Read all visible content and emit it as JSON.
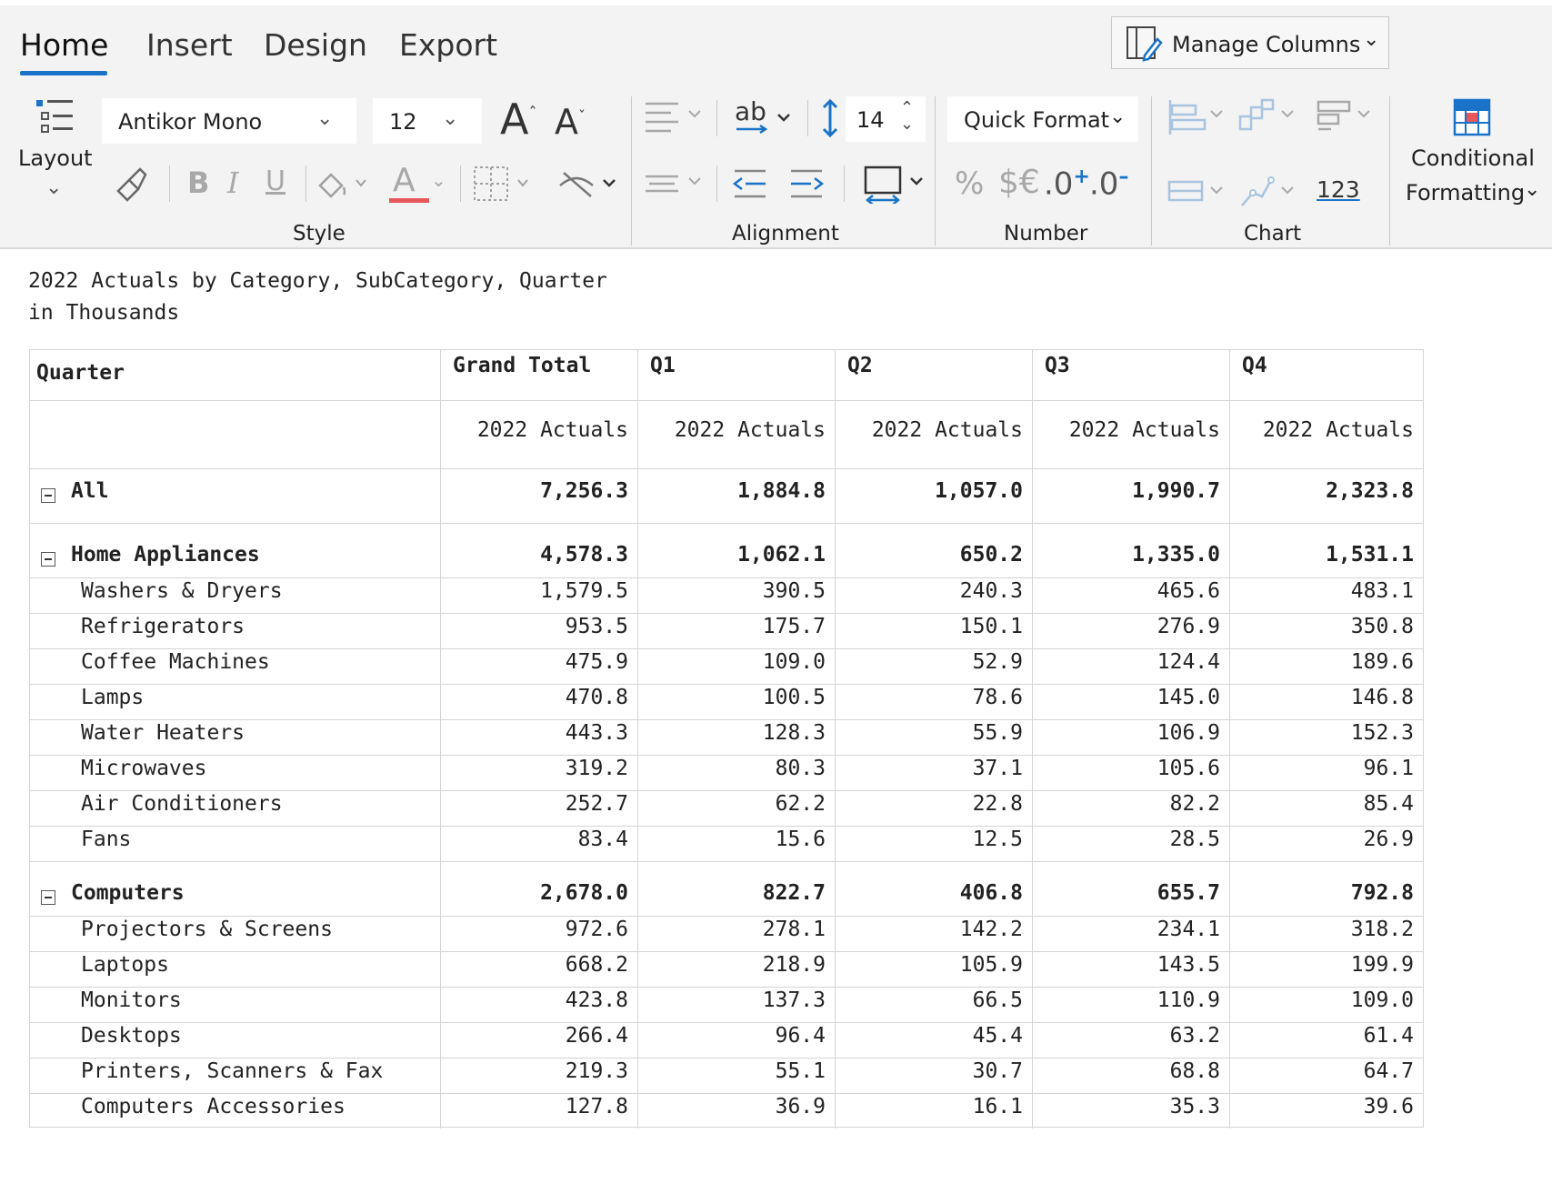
{
  "ribbon": {
    "tabs": [
      {
        "label": "Home",
        "active": true
      },
      {
        "label": "Insert",
        "active": false
      },
      {
        "label": "Design",
        "active": false
      },
      {
        "label": "Export",
        "active": false
      }
    ],
    "manage_columns_label": "Manage Columns",
    "layout_label": "Layout",
    "font_family": "Antikor Mono",
    "font_size": "12",
    "indent_value": "14",
    "quick_format_label": "Quick Format",
    "number_123_label": "123",
    "conditional_line1": "Conditional",
    "conditional_line2": "Formatting",
    "groups": {
      "style": "Style",
      "alignment": "Alignment",
      "number": "Number",
      "chart": "Chart"
    },
    "number_icons": {
      "percent": "%",
      "currency": "$€",
      "inc_decimal": ".0",
      "dec_decimal": ".0"
    },
    "font_color_underline": "#e8585a",
    "accent": "#1a73c8"
  },
  "report": {
    "title_line1": "2022 Actuals by Category, SubCategory, Quarter",
    "title_line2": "in Thousands",
    "header_row_label": "Quarter",
    "columns": [
      "Grand Total",
      "Q1",
      "Q2",
      "Q3",
      "Q4"
    ],
    "measure": "2022 Actuals",
    "rows": [
      {
        "label": "All",
        "level": 0,
        "bold": true,
        "collapsible": true,
        "values": [
          "7,256.3",
          "1,884.8",
          "1,057.0",
          "1,990.7",
          "2,323.8"
        ]
      },
      {
        "label": "Home Appliances",
        "level": 0,
        "bold": true,
        "collapsible": true,
        "values": [
          "4,578.3",
          "1,062.1",
          "650.2",
          "1,335.0",
          "1,531.1"
        ]
      },
      {
        "label": "Washers & Dryers",
        "level": 1,
        "bold": false,
        "collapsible": false,
        "values": [
          "1,579.5",
          "390.5",
          "240.3",
          "465.6",
          "483.1"
        ]
      },
      {
        "label": "Refrigerators",
        "level": 1,
        "bold": false,
        "collapsible": false,
        "values": [
          "953.5",
          "175.7",
          "150.1",
          "276.9",
          "350.8"
        ]
      },
      {
        "label": "Coffee Machines",
        "level": 1,
        "bold": false,
        "collapsible": false,
        "values": [
          "475.9",
          "109.0",
          "52.9",
          "124.4",
          "189.6"
        ]
      },
      {
        "label": "Lamps",
        "level": 1,
        "bold": false,
        "collapsible": false,
        "values": [
          "470.8",
          "100.5",
          "78.6",
          "145.0",
          "146.8"
        ]
      },
      {
        "label": "Water Heaters",
        "level": 1,
        "bold": false,
        "collapsible": false,
        "values": [
          "443.3",
          "128.3",
          "55.9",
          "106.9",
          "152.3"
        ]
      },
      {
        "label": "Microwaves",
        "level": 1,
        "bold": false,
        "collapsible": false,
        "values": [
          "319.2",
          "80.3",
          "37.1",
          "105.6",
          "96.1"
        ]
      },
      {
        "label": "Air Conditioners",
        "level": 1,
        "bold": false,
        "collapsible": false,
        "values": [
          "252.7",
          "62.2",
          "22.8",
          "82.2",
          "85.4"
        ]
      },
      {
        "label": "Fans",
        "level": 1,
        "bold": false,
        "collapsible": false,
        "values": [
          "83.4",
          "15.6",
          "12.5",
          "28.5",
          "26.9"
        ]
      },
      {
        "label": "Computers",
        "level": 0,
        "bold": true,
        "collapsible": true,
        "values": [
          "2,678.0",
          "822.7",
          "406.8",
          "655.7",
          "792.8"
        ]
      },
      {
        "label": "Projectors & Screens",
        "level": 1,
        "bold": false,
        "collapsible": false,
        "values": [
          "972.6",
          "278.1",
          "142.2",
          "234.1",
          "318.2"
        ]
      },
      {
        "label": "Laptops",
        "level": 1,
        "bold": false,
        "collapsible": false,
        "values": [
          "668.2",
          "218.9",
          "105.9",
          "143.5",
          "199.9"
        ]
      },
      {
        "label": "Monitors",
        "level": 1,
        "bold": false,
        "collapsible": false,
        "values": [
          "423.8",
          "137.3",
          "66.5",
          "110.9",
          "109.0"
        ]
      },
      {
        "label": "Desktops",
        "level": 1,
        "bold": false,
        "collapsible": false,
        "values": [
          "266.4",
          "96.4",
          "45.4",
          "63.2",
          "61.4"
        ]
      },
      {
        "label": "Printers, Scanners & Fax",
        "level": 1,
        "bold": false,
        "collapsible": false,
        "values": [
          "219.3",
          "55.1",
          "30.7",
          "68.8",
          "64.7"
        ]
      },
      {
        "label": "Computers Accessories",
        "level": 1,
        "bold": false,
        "collapsible": false,
        "values": [
          "127.8",
          "36.9",
          "16.1",
          "35.3",
          "39.6"
        ]
      }
    ]
  }
}
